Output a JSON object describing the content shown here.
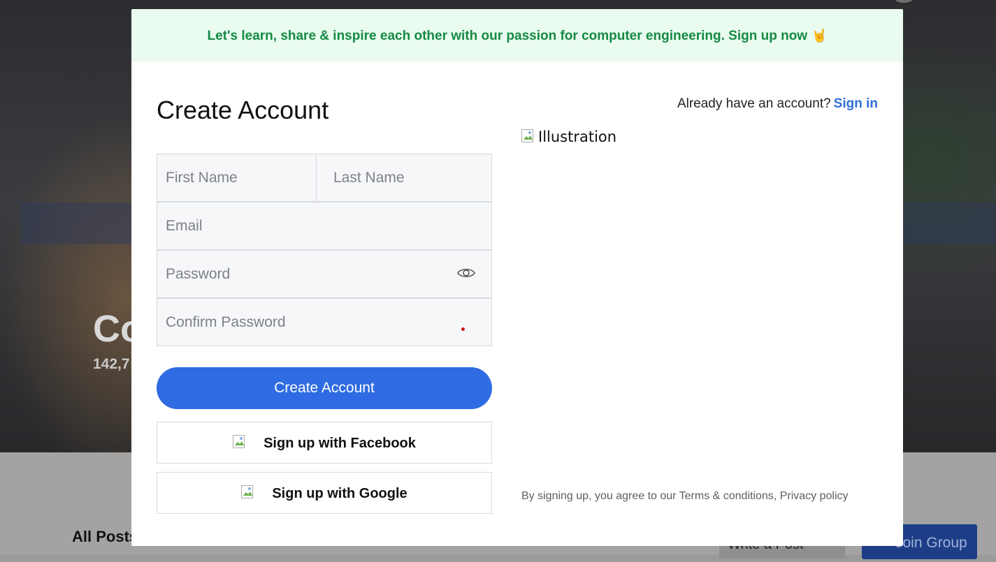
{
  "background": {
    "group_title": "Co",
    "member_count": "142,7",
    "all_posts_label": "All Posts",
    "write_post_label": "Write a Post",
    "join_group_label": "Join Group"
  },
  "modal": {
    "banner_text": "Let's learn, share & inspire each other with our passion for computer engineering. Sign up now",
    "banner_icon": "rock-on-hand-emoji",
    "title": "Create Account",
    "already_text": "Already have an account?",
    "signin_link": "Sign in",
    "fields": {
      "first_name_placeholder": "First Name",
      "last_name_placeholder": "Last Name",
      "email_placeholder": "Email",
      "password_placeholder": "Password",
      "confirm_password_placeholder": "Confirm Password"
    },
    "create_button": "Create Account",
    "facebook_button": "Sign up with Facebook",
    "google_button": "Sign up with Google",
    "illustration_alt": "Illustration",
    "terms_prefix": "By signing up, you agree to our",
    "terms_link": "Terms & conditions",
    "privacy_link": "Privacy policy"
  },
  "colors": {
    "accent": "#2f6be2",
    "banner_bg": "#eafbef",
    "banner_text": "#148a43",
    "link": "#2e6fd8"
  }
}
